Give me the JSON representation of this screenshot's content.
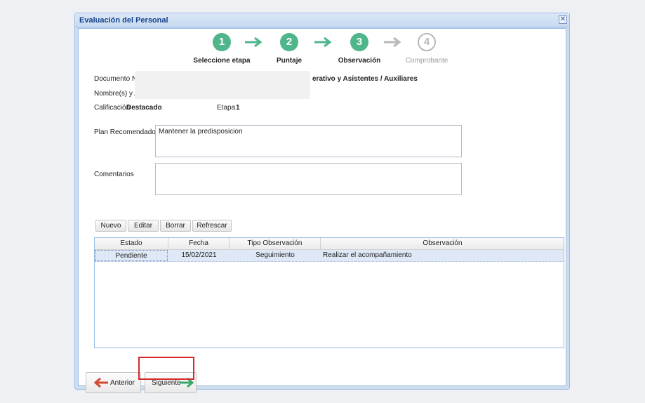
{
  "window": {
    "title": "Evaluación del Personal",
    "close_glyph": "✕"
  },
  "steps": [
    {
      "number": "1",
      "label": "Seleccione etapa",
      "status": "done"
    },
    {
      "number": "2",
      "label": "Puntaje",
      "status": "done"
    },
    {
      "number": "3",
      "label": "Observación",
      "status": "done"
    },
    {
      "number": "4",
      "label": "Comprobante",
      "status": "pending"
    }
  ],
  "colors": {
    "step_done": "#4fb58a",
    "step_pending": "#b8b8b8",
    "back_arrow": "#d2472f",
    "next_arrow": "#3aa86b",
    "highlight": "#d42a2a"
  },
  "info": {
    "documento_label": "Documento N°",
    "nombres_label": "Nombre(s) y Ap",
    "position_text": "erativo y Asistentes / Auxiliares",
    "calificacion_label": "Calificación",
    "calificacion_value": "Destacado",
    "etapa_label": "Etapa",
    "etapa_value": "1"
  },
  "form": {
    "plan_label": "Plan Recomendado",
    "plan_value": "Mantener la predisposicion",
    "comentarios_label": "Comentarios",
    "comentarios_value": ""
  },
  "toolbar": {
    "nuevo": "Nuevo",
    "editar": "Editar",
    "borrar": "Borrar",
    "refrescar": "Refrescar"
  },
  "grid": {
    "columns": [
      "Estado",
      "Fecha",
      "Tipo Observación",
      "Observación"
    ],
    "rows": [
      {
        "estado": "Pendiente",
        "fecha": "15/02/2021",
        "tipo": "Seguimiento",
        "observacion": "Realizar el acompañamiento"
      }
    ]
  },
  "nav": {
    "anterior": "Anterior",
    "siguiente": "Siguiente",
    "back_icon": "arrow-left-icon",
    "next_icon": "arrow-right-icon"
  }
}
